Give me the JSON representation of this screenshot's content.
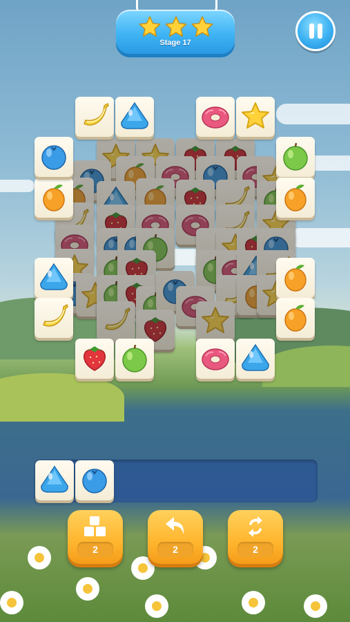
{
  "header": {
    "stage_label": "Stage 17",
    "stars_earned": 3,
    "stars_total": 3
  },
  "colors": {
    "panel_blue": "#3fb4f5",
    "star_gold": "#ffd23a",
    "button_orange": "#ffb52e",
    "tile_face": "#fffbf0"
  },
  "board": {
    "free_tiles": [
      "banana",
      "gem",
      "donut",
      "star",
      "apple",
      "orange",
      "orange",
      "gem",
      "orange",
      "banana",
      "orange",
      "strawberry",
      "apple",
      "donut",
      "gem",
      "blueberry"
    ],
    "covered_tiles": [
      "star",
      "star",
      "strawberry",
      "strawberry",
      "blueberry",
      "orange",
      "donut",
      "blueberry",
      "donut",
      "star",
      "orange",
      "gem",
      "orange",
      "strawberry",
      "banana",
      "apple",
      "banana",
      "strawberry",
      "donut",
      "donut",
      "banana",
      "star",
      "donut",
      "blueberry",
      "blueberry",
      "apple",
      "banana",
      "star",
      "strawberry",
      "blueberry",
      "star",
      "apple",
      "strawberry",
      "apple",
      "donut",
      "gem",
      "banana",
      "blueberry",
      "star",
      "apple",
      "strawberry",
      "banana",
      "orange",
      "star",
      "banana",
      "apple",
      "blueberry",
      "donut",
      "star",
      "strawberry"
    ]
  },
  "slot_bar": {
    "capacity": 7,
    "tiles": [
      "gem",
      "blueberry"
    ]
  },
  "powerups": [
    {
      "name": "shuffle-tiles",
      "icon": "blocks-icon",
      "count": "2"
    },
    {
      "name": "undo",
      "icon": "undo-arrow-icon",
      "count": "2"
    },
    {
      "name": "refresh",
      "icon": "refresh-icon",
      "count": "2"
    }
  ]
}
